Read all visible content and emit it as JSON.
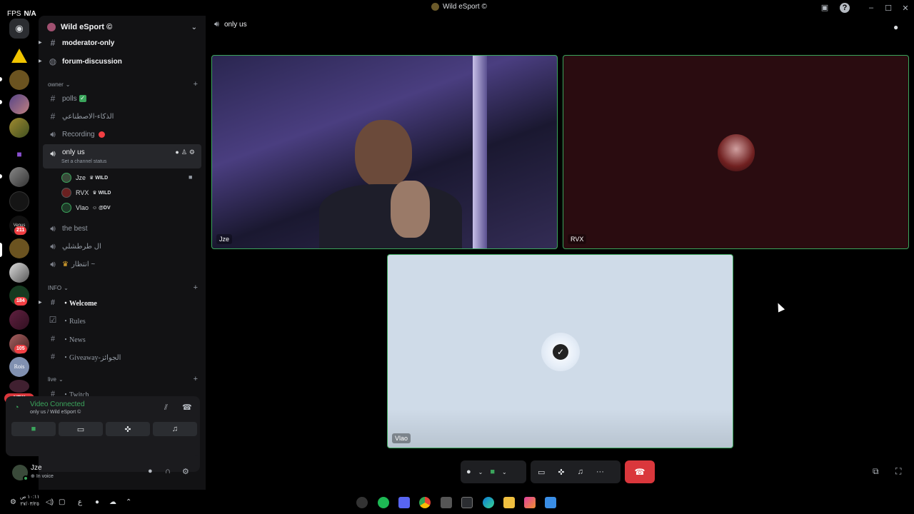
{
  "titlebar": {
    "fps_label": "FPS",
    "fps_value": "N/A",
    "window_title": "Wild eSport ©"
  },
  "server": {
    "name": "Wild eSport ©"
  },
  "rail": {
    "badges": [
      "211",
      "184",
      "105"
    ],
    "new_label": "NEW",
    "venus_label": "Venus",
    "rois_label": "Rois"
  },
  "channels": {
    "top": [
      {
        "name": "moderator-only",
        "icon": "hash-icon"
      },
      {
        "name": "forum-discussion",
        "icon": "forum-icon"
      }
    ],
    "owner_category": "owner",
    "owner_items": [
      {
        "name": "polls",
        "icon": "hash-icon"
      },
      {
        "name": "الذكاء-الاصطناعي",
        "icon": "hash-icon"
      },
      {
        "name": "Recording",
        "icon": "speaker-icon"
      },
      {
        "name": "only us",
        "icon": "speaker-icon"
      },
      {
        "name": "the best",
        "icon": "speaker-icon"
      },
      {
        "name": "ال طرطشلي",
        "icon": "speaker-icon"
      },
      {
        "name": "انتظار ~",
        "icon": "speaker-icon"
      }
    ],
    "channel_status_placeholder": "Set a channel status",
    "members": [
      {
        "name": "Jze",
        "tag": "WILD"
      },
      {
        "name": "RVX",
        "tag": "WILD"
      },
      {
        "name": "Vlao",
        "tag": "@DV"
      }
    ],
    "info_category": "INFO",
    "info_items": [
      {
        "name": "・Welcome",
        "icon": "hash-icon"
      },
      {
        "name": "・Rules",
        "icon": "rules-icon"
      },
      {
        "name": "・News",
        "icon": "hash-icon"
      },
      {
        "name": "・Giveaway-الجوائز",
        "icon": "hash-icon"
      }
    ],
    "live_category": "live",
    "live_items": [
      {
        "name": "・Twitch",
        "icon": "hash-icon"
      }
    ]
  },
  "voice": {
    "status": "Video Connected",
    "location": "only us / Wild eSport ©"
  },
  "user": {
    "name": "Jze",
    "status": "In voice"
  },
  "main": {
    "channel_name": "only us",
    "tiles": [
      {
        "name": "Jze"
      },
      {
        "name": "RVX"
      },
      {
        "name": "Vlao"
      }
    ]
  },
  "taskbar": {
    "time": "١٠:١١ ص",
    "date": "٢٧/٠٣/٢٥",
    "lang": "ع"
  },
  "colors": {
    "green": "#3ba55c",
    "red": "#da373c",
    "sidebar": "#121214",
    "rvx_tile": "#2a0c10",
    "vlao_tile": "#cfdbe8"
  }
}
